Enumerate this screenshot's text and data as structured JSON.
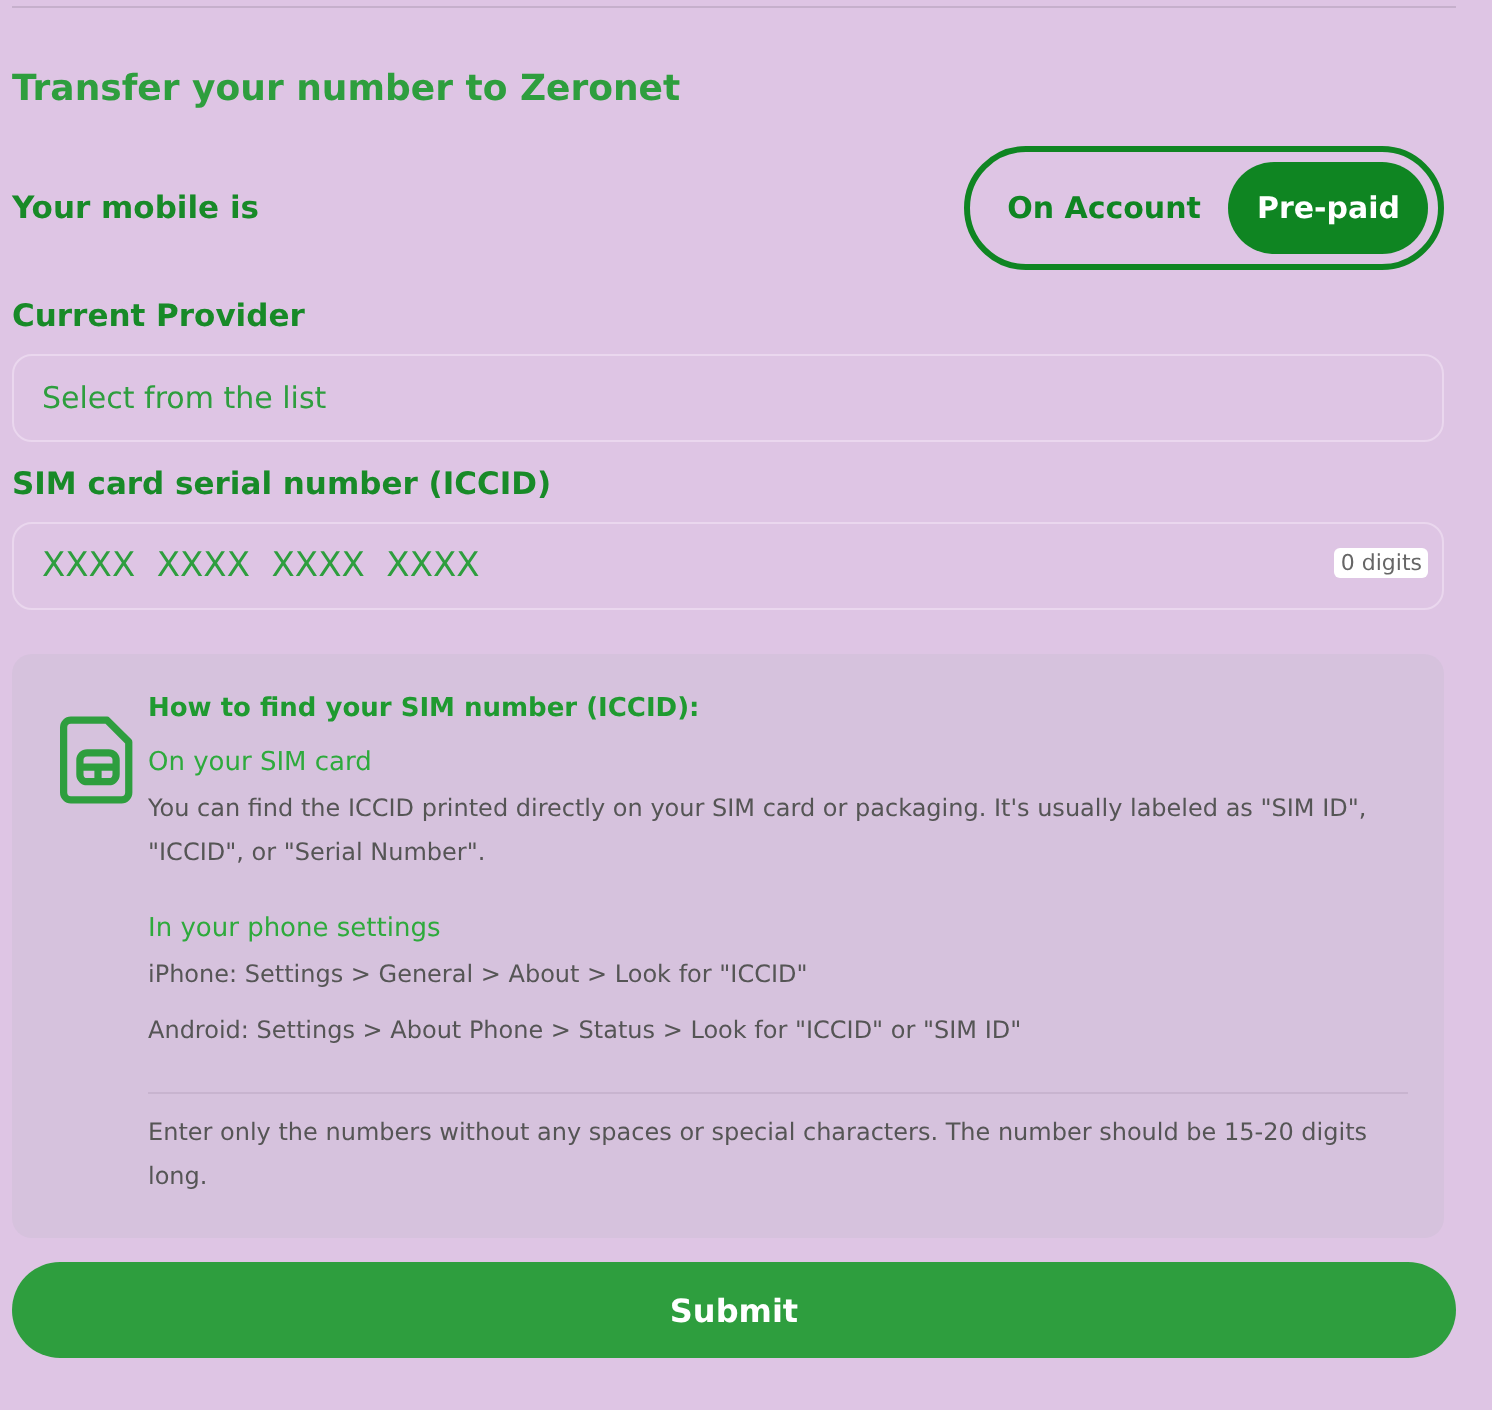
{
  "title": "Transfer your number to Zeronet",
  "account_type": {
    "label": "Your mobile is",
    "options": [
      {
        "label": "On Account",
        "selected": false
      },
      {
        "label": "Pre-paid",
        "selected": true
      }
    ]
  },
  "provider": {
    "label": "Current Provider",
    "placeholder": "Select from the list"
  },
  "iccid": {
    "label": "SIM card serial number (ICCID)",
    "placeholder": "XXXX  XXXX  XXXX  XXXX",
    "counter": "0 digits"
  },
  "help": {
    "heading": "How to find your SIM number (ICCID):",
    "sections": [
      {
        "heading": "On your SIM card",
        "lines": [
          "You can find the ICCID printed directly on your SIM card or packaging. It's usually labeled as \"SIM ID\", \"ICCID\", or \"Serial Number\"."
        ]
      },
      {
        "heading": "In your phone settings",
        "lines": [
          "iPhone: Settings > General > About > Look for \"ICCID\"",
          "Android: Settings > About Phone > Status > Look for \"ICCID\" or \"SIM ID\""
        ]
      }
    ],
    "note": "Enter only the numbers without any spaces or special characters. The number should be 15-20 digits long."
  },
  "submit": "Submit"
}
